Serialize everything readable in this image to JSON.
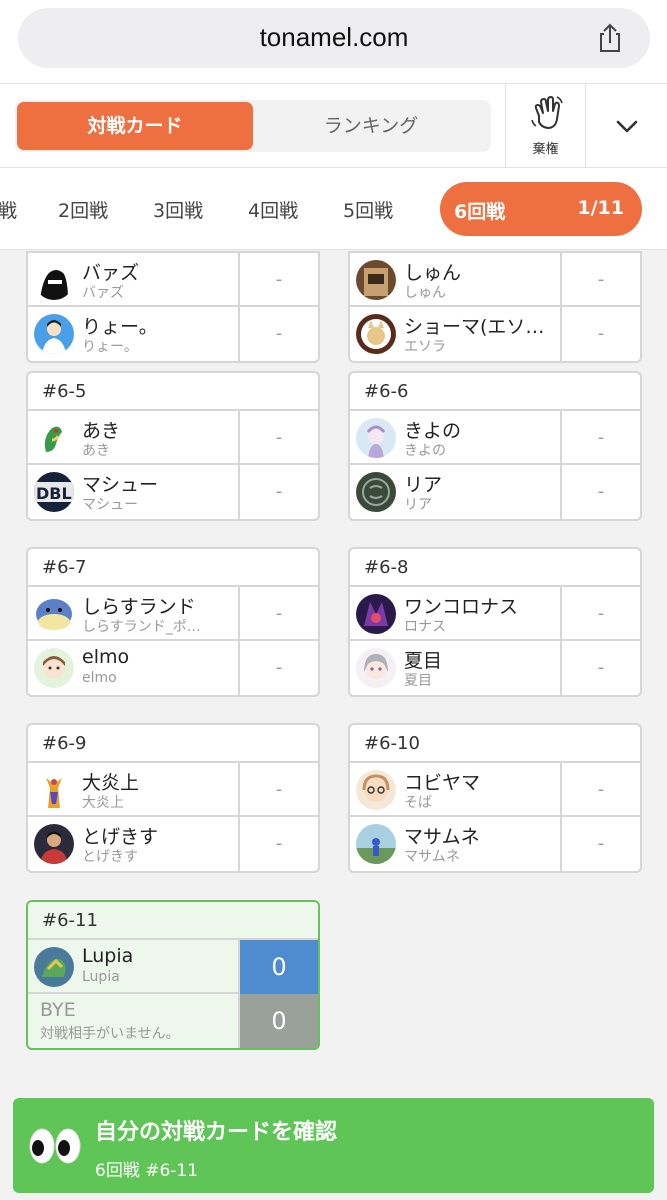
{
  "browser": {
    "url": "tonamel.com"
  },
  "header": {
    "tab_active": "対戦カード",
    "tab_inactive": "ランキング",
    "forfeit_label": "棄権"
  },
  "rounds": {
    "tabs": [
      "戦",
      "2回戦",
      "3回戦",
      "4回戦",
      "5回戦"
    ],
    "active_label": "6回戦",
    "active_count": "1/11"
  },
  "matches": [
    {
      "id": "",
      "players": [
        {
          "name": "バァズ",
          "user": "バァズ",
          "score": "-"
        },
        {
          "name": "りょー。",
          "user": "りょー。",
          "score": "-"
        }
      ]
    },
    {
      "id": "",
      "players": [
        {
          "name": "しゅん",
          "user": "しゅん",
          "score": "-"
        },
        {
          "name": "ショーマ(エソ…",
          "user": "エソラ",
          "score": "-"
        }
      ]
    },
    {
      "id": "#6-5",
      "players": [
        {
          "name": "あき",
          "user": "あき",
          "score": "-"
        },
        {
          "name": "マシュー",
          "user": "マシュー",
          "score": "-"
        }
      ]
    },
    {
      "id": "#6-6",
      "players": [
        {
          "name": "きよの",
          "user": "きよの",
          "score": "-"
        },
        {
          "name": "リア",
          "user": "リア",
          "score": "-"
        }
      ]
    },
    {
      "id": "#6-7",
      "players": [
        {
          "name": "しらすランド",
          "user": "しらすランド_ポ…",
          "score": "-"
        },
        {
          "name": "elmo",
          "user": "elmo",
          "score": "-"
        }
      ]
    },
    {
      "id": "#6-8",
      "players": [
        {
          "name": "ワンコロナス",
          "user": "ロナス",
          "score": "-"
        },
        {
          "name": "夏目",
          "user": "夏目",
          "score": "-"
        }
      ]
    },
    {
      "id": "#6-9",
      "players": [
        {
          "name": "大炎上",
          "user": "大炎上",
          "score": "-"
        },
        {
          "name": "とげきす",
          "user": "とげきす",
          "score": "-"
        }
      ]
    },
    {
      "id": "#6-10",
      "players": [
        {
          "name": "コビヤマ",
          "user": "そば",
          "score": "-"
        },
        {
          "name": "マサムネ",
          "user": "マサムネ",
          "score": "-"
        }
      ]
    },
    {
      "id": "#6-11",
      "players": [
        {
          "name": "Lupia",
          "user": "Lupia",
          "score": "0"
        },
        {
          "name": "BYE",
          "user": "対戦相手がいません。",
          "score": "0"
        }
      ]
    }
  ],
  "banner": {
    "title": "自分の対戦カードを確認",
    "subtitle": "6回戦 #6-11"
  },
  "colors": {
    "accent": "#ee7041",
    "green": "#5fc556",
    "score_blue": "#4f8ccf"
  }
}
